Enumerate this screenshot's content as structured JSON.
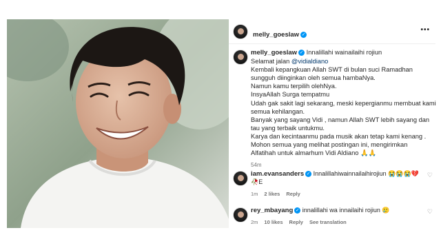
{
  "post": {
    "author": "melly_goeslaw",
    "more_icon": "•••"
  },
  "caption": {
    "author": "melly_goeslaw",
    "first_line": "Innalillahi wainailaihi rojiun",
    "mention_prefix": "Selamat jalan ",
    "mention": "@vidialdiano",
    "lines": [
      "Kembali kepangkuan Allah SWT di bulan suci Ramadhan",
      "sungguh diinginkan oleh semua hambaNya.",
      "Namun kamu terpilih olehNya.",
      "InsyaAllah Surga tempatmu",
      "Udah gak sakit lagi sekarang, meski kepergianmu membuat kami",
      "semua kehilangan.",
      "Banyak yang sayang Vidi , namun Allah SWT lebih sayang dan",
      "tau yang terbaik untukmu.",
      "Karya dan kecintaanmu pada musik akan tetap kami kenang .",
      "Mohon semua yang melihat postingan ini, mengirimkan",
      "Alfatihah untuk almarhum Vidi Aldiano 🙏🙏"
    ],
    "time": "54m"
  },
  "comments": [
    {
      "author": "iam.evansanders",
      "text": "Innalillahiwainnailaihirojiun 😭😭😭💔",
      "text_line2": "🥀E",
      "time": "1m",
      "likes": "2 likes",
      "reply": "Reply"
    },
    {
      "author": "rey_mbayang",
      "text": "innalillahi wa innailaihi rojiun 🥲",
      "time": "2m",
      "likes": "10 likes",
      "reply": "Reply",
      "translation": "See translation"
    }
  ],
  "icons": {
    "verified": "verified-badge-icon",
    "heart": "heart-outline-icon",
    "more": "more-options-icon"
  },
  "colors": {
    "verified": "#0095f6",
    "mention": "#00376b",
    "secondary_text": "#737373"
  }
}
